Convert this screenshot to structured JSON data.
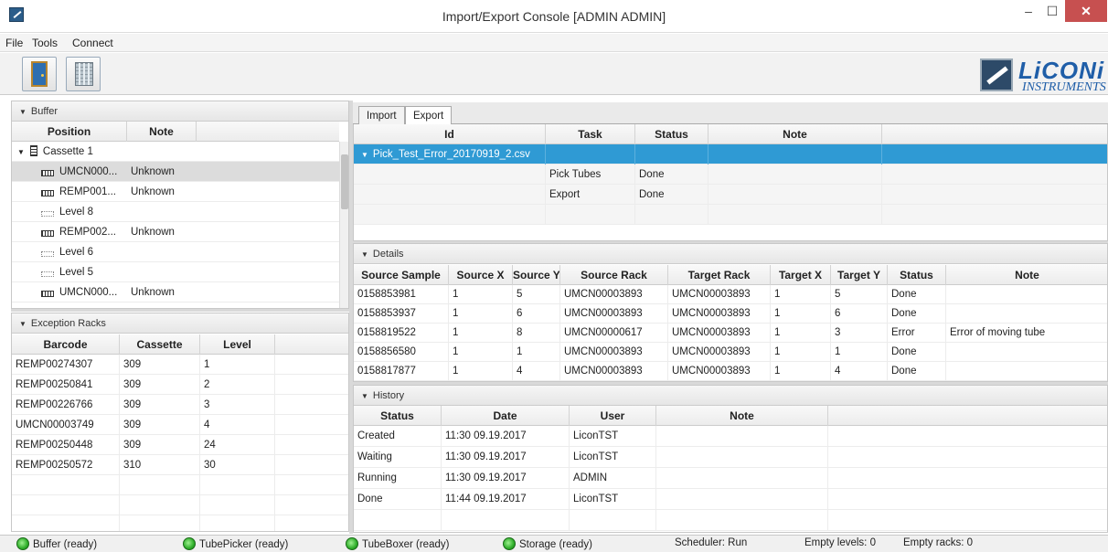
{
  "window": {
    "title": "Import/Export Console [ADMIN ADMIN]",
    "minimize": "–",
    "maximize": "☐",
    "close": "✕"
  },
  "menu": {
    "items": [
      "File",
      "Tools",
      "Connect"
    ]
  },
  "toolbar": {
    "buttons": [
      "door-icon",
      "building-icon"
    ]
  },
  "logo": {
    "name": "LiCONi",
    "sub": "INSTRUMENTS"
  },
  "buffer": {
    "header": "Buffer",
    "columns": [
      "Position",
      "Note"
    ],
    "cassette": "Cassette 1",
    "rows": [
      {
        "label": "UMCN000...",
        "note": "Unknown",
        "icon": "rack-icon"
      },
      {
        "label": "REMP001...",
        "note": "Unknown",
        "icon": "rack-icon"
      },
      {
        "label": "Level 8",
        "note": "",
        "icon": "level-icon"
      },
      {
        "label": "REMP002...",
        "note": "Unknown",
        "icon": "rack-icon"
      },
      {
        "label": "Level 6",
        "note": "",
        "icon": "level-icon"
      },
      {
        "label": "Level 5",
        "note": "",
        "icon": "level-icon"
      },
      {
        "label": "UMCN000...",
        "note": "Unknown",
        "icon": "rack-icon"
      }
    ]
  },
  "exception_racks": {
    "header": "Exception Racks",
    "columns": [
      "Barcode",
      "Cassette",
      "Level"
    ],
    "rows": [
      [
        "REMP00274307",
        "309",
        "1"
      ],
      [
        "REMP00250841",
        "309",
        "2"
      ],
      [
        "REMP00226766",
        "309",
        "3"
      ],
      [
        "UMCN00003749",
        "309",
        "4"
      ],
      [
        "REMP00250448",
        "309",
        "24"
      ],
      [
        "REMP00250572",
        "310",
        "30"
      ]
    ]
  },
  "tabs": [
    "Import",
    "Export"
  ],
  "export_table": {
    "columns": [
      "Id",
      "Task",
      "Status",
      "Note"
    ],
    "group": "Pick_Test_Error_20170919_2.csv",
    "rows": [
      [
        "",
        "Pick Tubes",
        "Done",
        ""
      ],
      [
        "",
        "Export",
        "Done",
        ""
      ]
    ]
  },
  "details": {
    "header": "Details",
    "columns": [
      "Source Sample",
      "Source X",
      "Source Y",
      "Source Rack",
      "Target Rack",
      "Target X",
      "Target Y",
      "Status",
      "Note"
    ],
    "rows": [
      [
        "0158853981",
        "1",
        "5",
        "UMCN00003893",
        "UMCN00003893",
        "1",
        "5",
        "Done",
        ""
      ],
      [
        "0158853937",
        "1",
        "6",
        "UMCN00003893",
        "UMCN00003893",
        "1",
        "6",
        "Done",
        ""
      ],
      [
        "0158819522",
        "1",
        "8",
        "UMCN00000617",
        "UMCN00003893",
        "1",
        "3",
        "Error",
        "Error of moving tube"
      ],
      [
        "0158856580",
        "1",
        "1",
        "UMCN00003893",
        "UMCN00003893",
        "1",
        "1",
        "Done",
        ""
      ],
      [
        "0158817877",
        "1",
        "4",
        "UMCN00003893",
        "UMCN00003893",
        "1",
        "4",
        "Done",
        ""
      ]
    ]
  },
  "history": {
    "header": "History",
    "columns": [
      "Status",
      "Date",
      "User",
      "Note"
    ],
    "rows": [
      [
        "Created",
        "11:30 09.19.2017",
        "LiconTST",
        ""
      ],
      [
        "Waiting",
        "11:30 09.19.2017",
        "LiconTST",
        ""
      ],
      [
        "Running",
        "11:30 09.19.2017",
        "ADMIN",
        ""
      ],
      [
        "Done",
        "11:44 09.19.2017",
        "LiconTST",
        ""
      ]
    ]
  },
  "status": {
    "buffer": "Buffer (ready)",
    "tubepicker": "TubePicker (ready)",
    "tubeboxer": "TubeBoxer (ready)",
    "storage": "Storage (ready)",
    "scheduler": "Scheduler: Run",
    "empty_levels": "Empty levels: 0",
    "empty_racks": "Empty racks: 0",
    "led_color": "#2fae2a"
  }
}
